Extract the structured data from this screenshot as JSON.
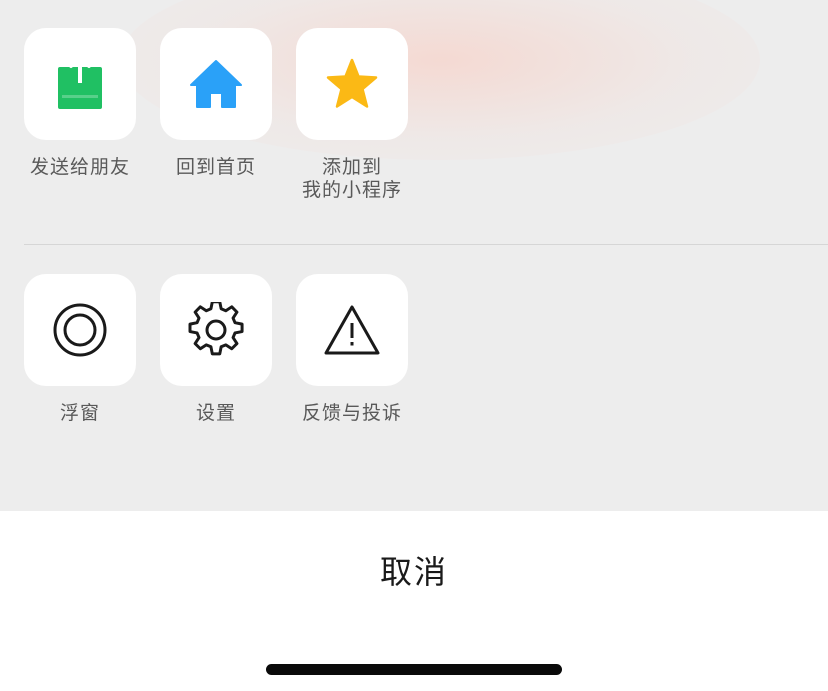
{
  "menu": {
    "row1": [
      {
        "label_lines": [
          "发送给朋友"
        ],
        "icon": "share-icon",
        "color": "#20c063"
      },
      {
        "label_lines": [
          "回到首页"
        ],
        "icon": "home-icon",
        "color": "#2aa1f8"
      },
      {
        "label_lines": [
          "添加到",
          "我的小程序"
        ],
        "icon": "star-icon",
        "color": "#fbb915"
      }
    ],
    "row2": [
      {
        "label_lines": [
          "浮窗"
        ],
        "icon": "floating-window-icon",
        "color": "#1a1a1a"
      },
      {
        "label_lines": [
          "设置"
        ],
        "icon": "gear-icon",
        "color": "#1a1a1a"
      },
      {
        "label_lines": [
          "反馈与投诉"
        ],
        "icon": "warning-icon",
        "color": "#1a1a1a"
      }
    ]
  },
  "cancel": {
    "label": "取消"
  },
  "colors": {
    "sheet_background": "#ededed",
    "tile_background": "#ffffff",
    "label_text": "#595959",
    "cancel_text": "#1a1a1a"
  }
}
